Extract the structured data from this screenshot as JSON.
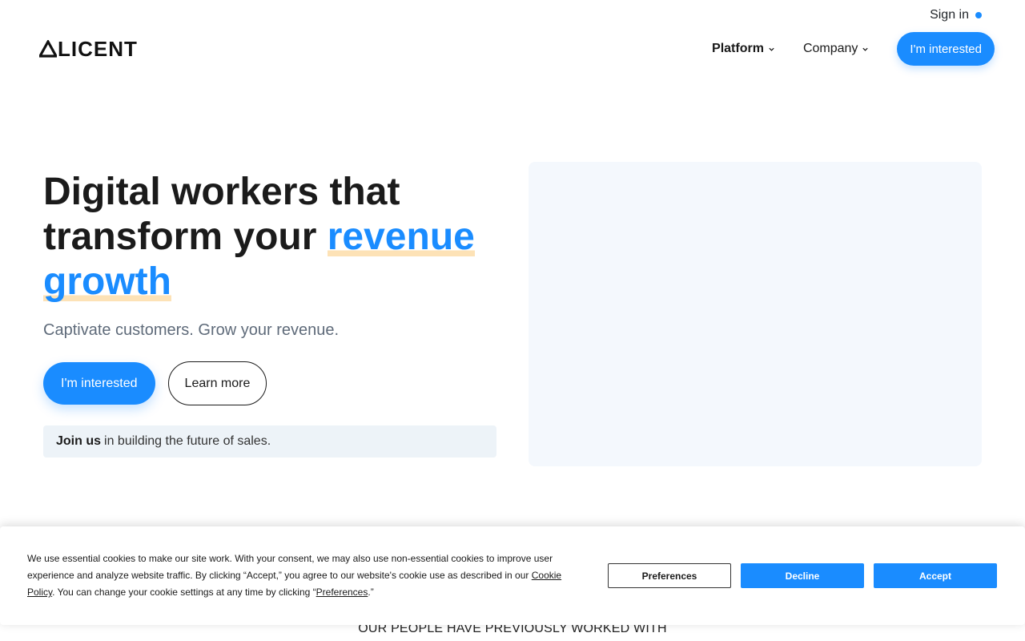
{
  "topbar": {
    "signin_label": "Sign in"
  },
  "header": {
    "logo_text": "LICENT",
    "nav": [
      {
        "label": "Platform"
      },
      {
        "label": "Company"
      }
    ],
    "cta_label": "I'm interested"
  },
  "hero": {
    "title_part1": "Digital workers that transform your ",
    "title_highlight1": "revenue",
    "title_highlight2": "growth",
    "subtitle": "Captivate customers. Grow your revenue.",
    "primary_cta": "I'm interested",
    "secondary_cta": "Learn more",
    "join_bold": "Join us",
    "join_rest": "in building the future of sales."
  },
  "section": {
    "people_heading": "OUR PEOPLE HAVE PREVIOUSLY WORKED WITH"
  },
  "cookie": {
    "text_1": "We use essential cookies to make our site work. With your consent, we may also use non-essential cookies to improve user experience and analyze website traffic. By clicking “Accept,” you agree to our website's cookie use as described in our ",
    "link_policy": "Cookie Policy",
    "text_2": ". You can change your cookie settings at any time by clicking “",
    "link_prefs": "Preferences",
    "text_3": ".”",
    "buttons": {
      "preferences": "Preferences",
      "decline": "Decline",
      "accept": "Accept"
    }
  },
  "colors": {
    "accent": "#1a8cff",
    "highlight_underline": "#fde2b6",
    "join_bg": "#edf3f8",
    "media_bg": "#f4f8fd"
  }
}
